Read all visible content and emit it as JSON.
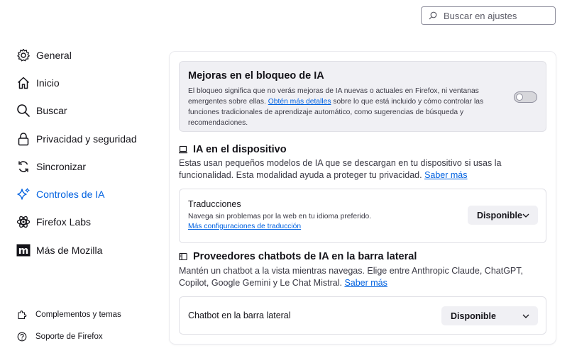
{
  "search": {
    "placeholder": "Buscar en ajustes"
  },
  "sidebar": {
    "items": [
      {
        "label": "General",
        "icon": "gear-icon"
      },
      {
        "label": "Inicio",
        "icon": "home-icon"
      },
      {
        "label": "Buscar",
        "icon": "search-icon"
      },
      {
        "label": "Privacidad y seguridad",
        "icon": "lock-icon"
      },
      {
        "label": "Sincronizar",
        "icon": "sync-icon"
      },
      {
        "label": "Controles de IA",
        "icon": "sparkle-icon"
      },
      {
        "label": "Firefox Labs",
        "icon": "atom-icon"
      },
      {
        "label": "Más de Mozilla",
        "icon": "mozilla-icon"
      }
    ],
    "footer": [
      {
        "label": "Complementos y temas",
        "icon": "puzzle-icon"
      },
      {
        "label": "Soporte de Firefox",
        "icon": "help-icon"
      }
    ]
  },
  "block": {
    "title": "Mejoras en el bloqueo de IA",
    "desc_before": "El bloqueo significa que no verás mejoras de IA nuevas o actuales en Firefox, ni ventanas emergentes sobre ellas. ",
    "desc_link": "Obtén más detalles",
    "desc_after": " sobre lo que está incluido y cómo controlar las funciones tradicionales de aprendizaje automático, como sugerencias de búsqueda y recomendaciones."
  },
  "on_device": {
    "title": "IA en el dispositivo",
    "desc": "Estas usan pequeños modelos de IA que se descargan en tu dispositivo si usas la funcionalidad. Esta modalidad ayuda a proteger tu privacidad. ",
    "link": "Saber más",
    "translations": {
      "title": "Traducciones",
      "sub": "Navega sin problemas por la web en tu idioma preferido.",
      "link": "Más configuraciones de traducción",
      "value": "Disponible"
    }
  },
  "chatbots": {
    "title": "Proveedores chatbots de IA en la barra lateral",
    "desc": "Mantén un chatbot a la vista mientras navegas. Elige entre Anthropic Claude, ChatGPT, Copilot, Google Gemini y Le Chat Mistral. ",
    "link": "Saber más",
    "sidebar_chatbot": {
      "title": "Chatbot en la barra lateral",
      "value": "Disponible"
    }
  },
  "colors": {
    "accent": "#0061e0",
    "text": "#15141a"
  }
}
